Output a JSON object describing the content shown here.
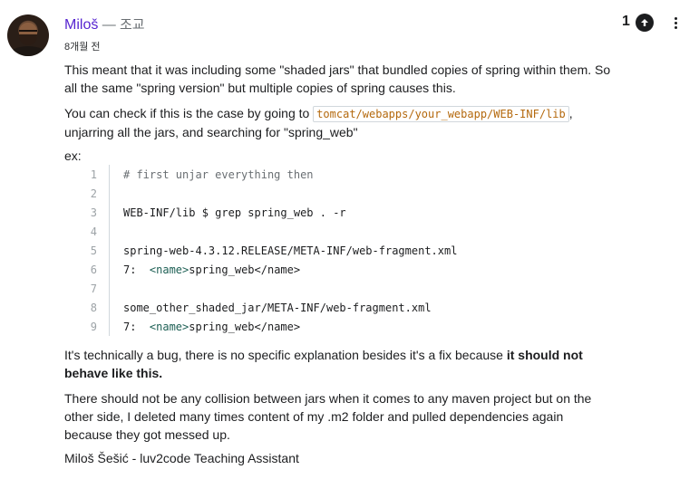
{
  "post": {
    "author": "Miloš",
    "role": "— 조교",
    "time": "8개월 전",
    "votes": "1",
    "p1": "This meant that it was including some \"shaded jars\" that bundled copies of spring within them. So all the same \"spring version\" but multiple copies of spring causes this.",
    "p2_before": "You can check if this is the case by going to ",
    "p2_code": "tomcat/webapps/your_webapp/WEB-INF/lib",
    "p2_after": ", unjarring all the jars, and searching for \"spring_web\"",
    "ex_label": "ex:",
    "p3_normal": "It's technically a bug, there is no specific explanation besides it's a fix because ",
    "p3_bold": "it should not behave like this.",
    "p4": "There should not be any collision between jars when it comes to any maven project but on the other side, I deleted many times content of my .m2 folder and pulled dependencies again because they got messed up.",
    "signature": "Miloš Šešić - luv2code Teaching Assistant"
  },
  "code": {
    "lines": [
      {
        "n": "1",
        "text": "# first unjar everything then"
      },
      {
        "n": "2",
        "text": ""
      },
      {
        "n": "3",
        "text": "WEB-INF/lib $ grep spring_web . -r"
      },
      {
        "n": "4",
        "text": ""
      },
      {
        "n": "5",
        "text": "spring-web-4.3.12.RELEASE/META-INF/web-fragment.xml"
      },
      {
        "n": "6",
        "prefix": "7:  ",
        "tag_open": "<name>",
        "inner": "spring_web",
        "tag_close": "</name>"
      },
      {
        "n": "7",
        "text": ""
      },
      {
        "n": "8",
        "text": "some_other_shaded_jar/META-INF/web-fragment.xml"
      },
      {
        "n": "9",
        "prefix": "7:  ",
        "tag_open": "<name>",
        "inner": "spring_web",
        "tag_close": "</name>"
      }
    ]
  },
  "icons": {
    "upvote": "arrow-up-icon",
    "more": "more-vertical-icon"
  },
  "colors": {
    "author": "#5624d0",
    "inline_code": "#b4690e",
    "xml_tag": "#1e6055"
  }
}
